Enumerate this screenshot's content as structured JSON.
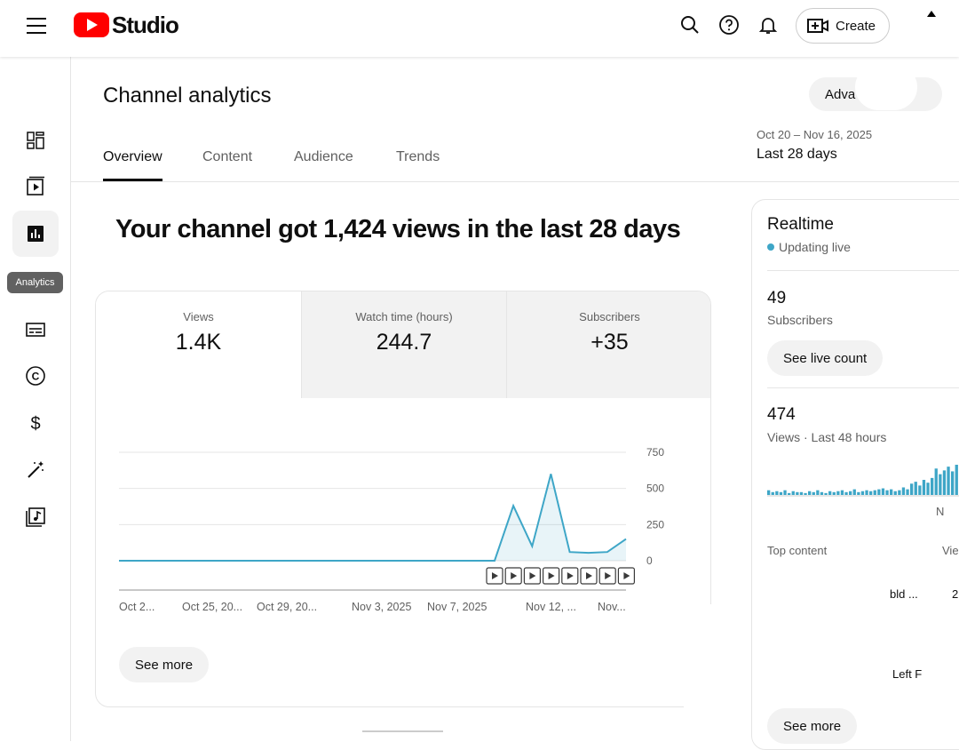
{
  "app": {
    "logo_text": "Studio",
    "brand_color": "#ff0000"
  },
  "header": {
    "create_label": "Create",
    "icons": [
      "hamburger-menu-icon",
      "search-icon",
      "help-icon",
      "bell-icon",
      "create-video-icon"
    ]
  },
  "sidebar": {
    "items": [
      {
        "name": "dashboard-icon"
      },
      {
        "name": "content-icon"
      },
      {
        "name": "analytics-icon",
        "active": true
      },
      {
        "name": "subtitles-icon"
      },
      {
        "name": "copyright-icon"
      },
      {
        "name": "earn-icon"
      },
      {
        "name": "customization-icon"
      },
      {
        "name": "audio-library-icon"
      }
    ],
    "tooltip": "Analytics"
  },
  "page": {
    "title": "Channel analytics",
    "advanced_mode_label": "Adva    d mode",
    "tabs": [
      "Overview",
      "Content",
      "Audience",
      "Trends"
    ],
    "active_tab": "Overview",
    "date_range": {
      "dates": "Oct 20 – Nov 16, 2025",
      "label": "Last 28 days"
    },
    "headline": "Your channel got 1,424 views in the last 28 days"
  },
  "metrics": [
    {
      "label": "Views",
      "value": "1.4K"
    },
    {
      "label": "Watch time (hours)",
      "value": "244.7"
    },
    {
      "label": "Subscribers",
      "value": "+35"
    }
  ],
  "chart_data": {
    "type": "area",
    "x_tick_labels": [
      "Oct 2...",
      "Oct 25, 20...",
      "Oct 29, 20...",
      "Nov 3, 2025",
      "Nov 7, 2025",
      "Nov 12, ...",
      "Nov..."
    ],
    "y_tick_labels": [
      "750",
      "500",
      "250",
      "0"
    ],
    "ylim": [
      0,
      750
    ],
    "series": [
      {
        "values": [
          0,
          0,
          0,
          0,
          0,
          0,
          0,
          0,
          0,
          0,
          0,
          0,
          0,
          0,
          0,
          0,
          0,
          0,
          0,
          0,
          0,
          380,
          100,
          600,
          60,
          55,
          60,
          150
        ]
      }
    ],
    "color": "#3ea6c7",
    "video_markers": 8
  },
  "card": {
    "see_more_label": "See more"
  },
  "realtime": {
    "title": "Realtime",
    "status": "Updating live",
    "subscribers_count": "49",
    "subscribers_label": "Subscribers",
    "see_live_label": "See live count",
    "views_count": "474",
    "views_label": "Views · Last 48 hours",
    "axis_end_label": "N",
    "top_content_label": "Top content",
    "views_col_label": "Vie",
    "row1_title_fragment": "bld ...",
    "row1_value_fragment": "2",
    "row2_title_fragment": "Left F",
    "see_more_label": "See more",
    "bars": [
      5,
      3,
      4,
      3,
      5,
      2,
      4,
      3,
      3,
      2,
      4,
      3,
      5,
      3,
      2,
      4,
      3,
      4,
      5,
      3,
      4,
      6,
      3,
      4,
      5,
      4,
      5,
      6,
      7,
      5,
      6,
      4,
      5,
      8,
      6,
      12,
      14,
      10,
      16,
      13,
      18,
      28,
      22,
      26,
      30,
      25,
      32,
      24
    ]
  }
}
